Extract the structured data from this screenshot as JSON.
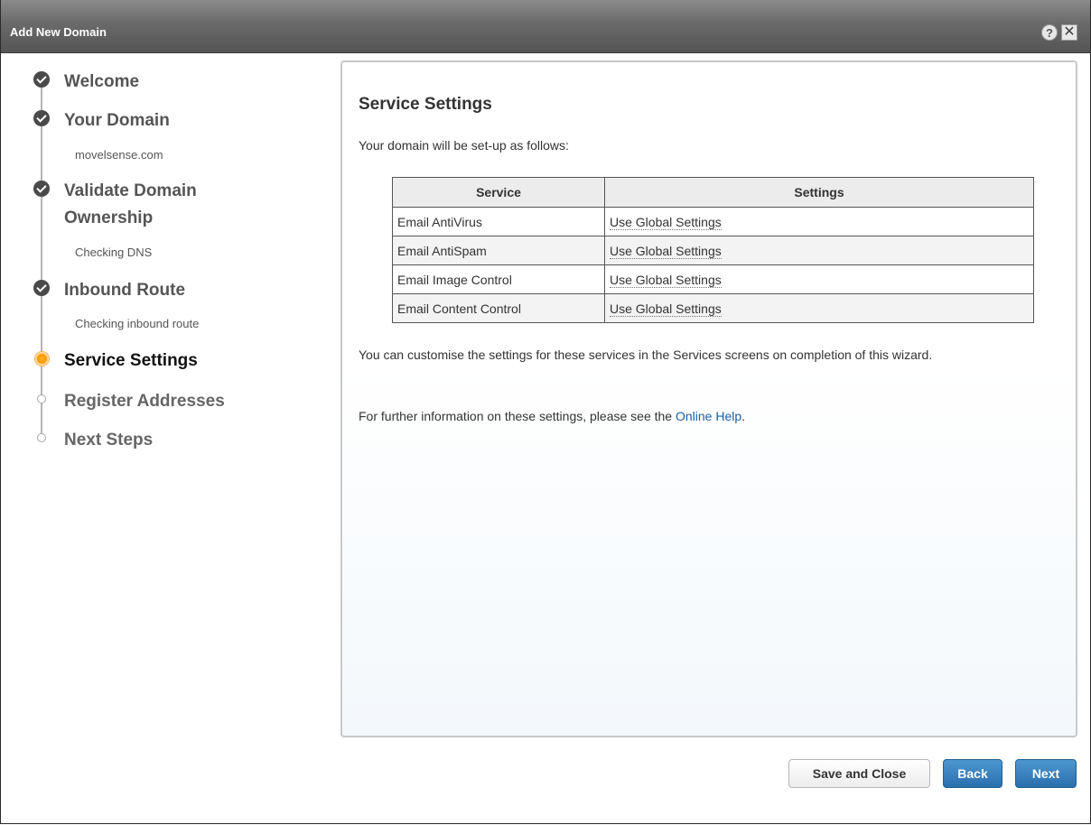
{
  "window": {
    "title": "Add New Domain",
    "help_glyph": "?",
    "close_glyph": "✕"
  },
  "steps": [
    {
      "label": "Welcome",
      "state": "done",
      "sub": ""
    },
    {
      "label": "Your Domain",
      "state": "done",
      "sub": "movelsense.com"
    },
    {
      "label": "Validate Domain",
      "label_line2": "Ownership",
      "state": "done",
      "sub": "Checking DNS"
    },
    {
      "label": "Inbound Route",
      "state": "done",
      "sub": "Checking inbound route"
    },
    {
      "label": "Service Settings",
      "state": "current",
      "sub": ""
    },
    {
      "label": "Register Addresses",
      "state": "todo",
      "sub": ""
    },
    {
      "label": "Next Steps",
      "state": "todo",
      "sub": ""
    }
  ],
  "main": {
    "heading": "Service Settings",
    "intro": "Your domain will be set-up as follows:",
    "table": {
      "headers": [
        "Service",
        "Settings"
      ],
      "rows": [
        [
          "Email AntiVirus",
          "Use Global Settings"
        ],
        [
          "Email AntiSpam",
          "Use Global Settings"
        ],
        [
          "Email Image Control",
          "Use Global Settings"
        ],
        [
          "Email Content Control",
          "Use Global Settings"
        ]
      ]
    },
    "note1": "You can customise the settings for these services in the Services screens on completion of this wizard.",
    "note2_prefix": "For further information on these settings, please see the ",
    "note2_link": "Online Help",
    "note2_suffix": "."
  },
  "footer": {
    "save_close_label": "Save and Close",
    "back_label": "Back",
    "next_label": "Next"
  },
  "colors": {
    "titlebar": "#6a6a6a",
    "primary_button": "#2a6fae",
    "current_step": "#ff9800",
    "link": "#1a5fa8"
  }
}
